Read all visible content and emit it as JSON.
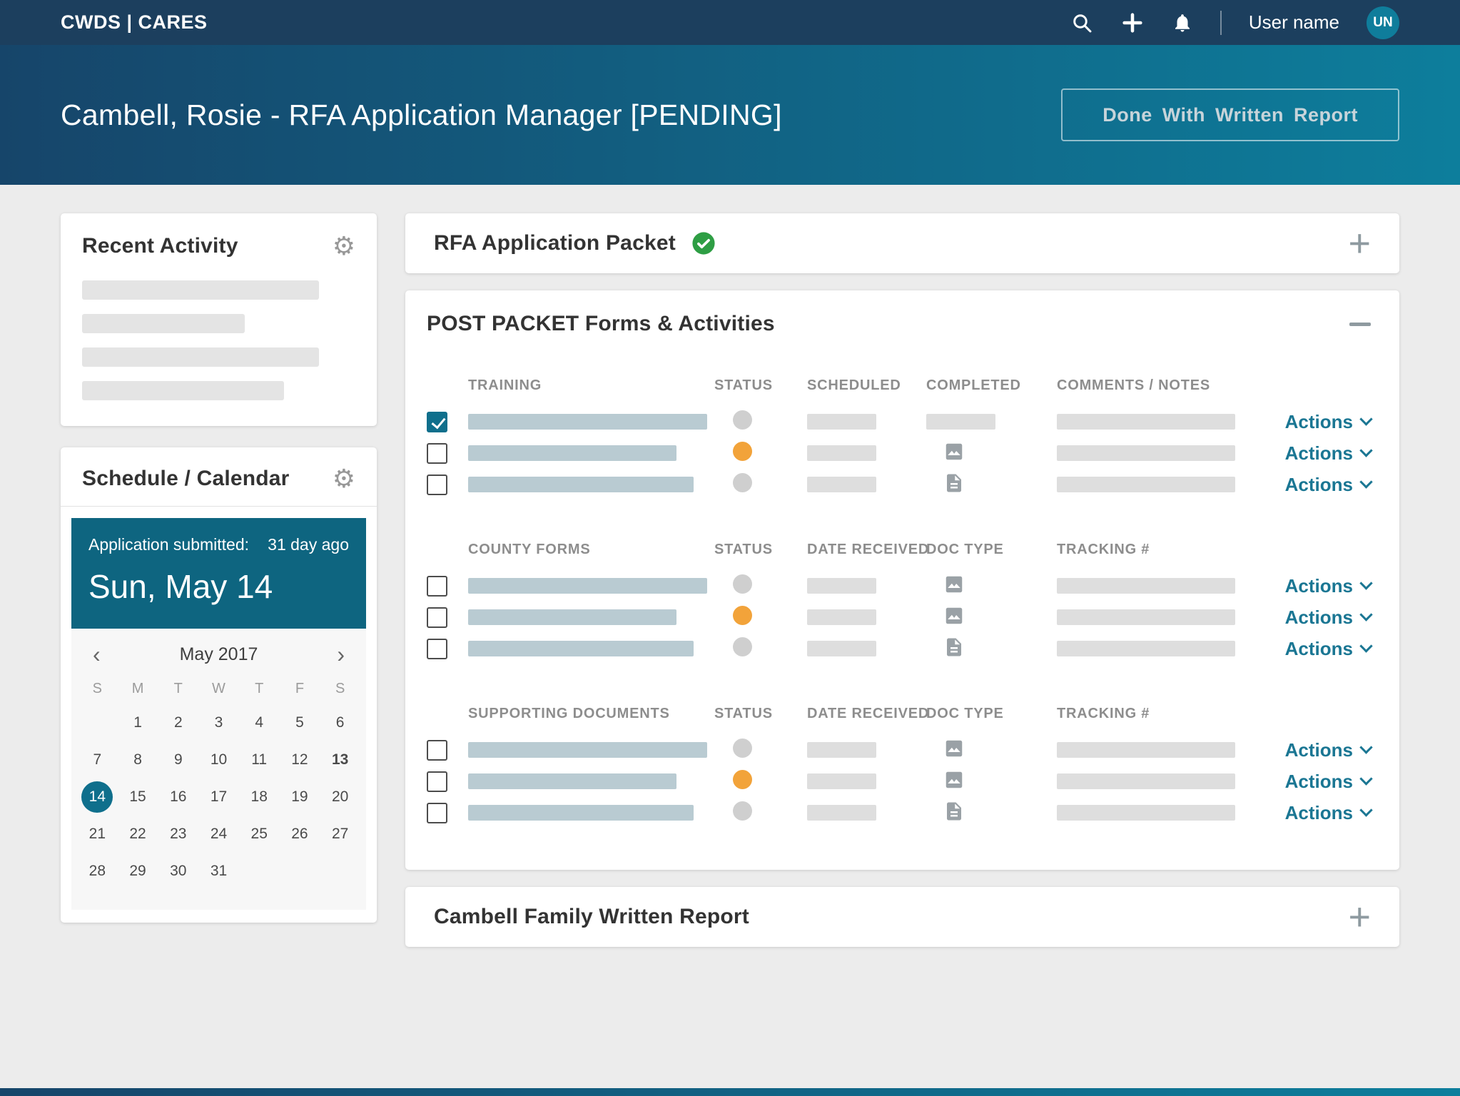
{
  "navbar": {
    "brand": "CWDS | CARES",
    "user_name": "User name",
    "avatar_initials": "UN"
  },
  "header": {
    "title": "Cambell, Rosie - RFA Application Manager [PENDING]",
    "button_label": "Done With Written Report"
  },
  "recent_activity": {
    "title": "Recent Activity"
  },
  "calendar_card": {
    "title": "Schedule / Calendar",
    "submitted_label": "Application submitted:",
    "submitted_ago": "31 day ago",
    "selected_date": "Sun, May 14",
    "month": "May 2017",
    "weekdays": [
      "S",
      "M",
      "T",
      "W",
      "T",
      "F",
      "S"
    ],
    "weeks": [
      [
        "",
        "1",
        "2",
        "3",
        "4",
        "5",
        "6"
      ],
      [
        "7",
        "8",
        "9",
        "10",
        "11",
        "12",
        "13"
      ],
      [
        "14",
        "15",
        "16",
        "17",
        "18",
        "19",
        "20"
      ],
      [
        "21",
        "22",
        "23",
        "24",
        "25",
        "26",
        "27"
      ],
      [
        "28",
        "29",
        "30",
        "31",
        "",
        "",
        ""
      ]
    ],
    "teal_days": [
      "7",
      "19",
      "25"
    ],
    "bold_days": [
      "13"
    ],
    "selected_day": "14"
  },
  "packet_card": {
    "title": "RFA Application Packet"
  },
  "post_packet": {
    "title": "POST PACKET Forms & Activities",
    "actions_label": "Actions",
    "sections": [
      {
        "headers": [
          "TRAINING",
          "STATUS",
          "SCHEDULED",
          "COMPLETED",
          "COMMENTS / NOTES"
        ],
        "rows": [
          {
            "checked": true,
            "status": "gray",
            "doc": "bar"
          },
          {
            "checked": false,
            "status": "orange",
            "doc": "image"
          },
          {
            "checked": false,
            "status": "gray",
            "doc": "doc"
          }
        ]
      },
      {
        "headers": [
          "COUNTY FORMS",
          "STATUS",
          "DATE RECEIVED",
          "DOC TYPE",
          "TRACKING #"
        ],
        "rows": [
          {
            "checked": false,
            "status": "gray",
            "doc": "image"
          },
          {
            "checked": false,
            "status": "orange",
            "doc": "image"
          },
          {
            "checked": false,
            "status": "gray",
            "doc": "doc"
          }
        ]
      },
      {
        "headers": [
          "SUPPORTING DOCUMENTS",
          "STATUS",
          "DATE RECEIVED",
          "DOC TYPE",
          "TRACKING #"
        ],
        "rows": [
          {
            "checked": false,
            "status": "gray",
            "doc": "image"
          },
          {
            "checked": false,
            "status": "orange",
            "doc": "image"
          },
          {
            "checked": false,
            "status": "gray",
            "doc": "doc"
          }
        ]
      }
    ]
  },
  "written_report": {
    "title": "Cambell Family Written Report"
  },
  "colors": {
    "accent_teal": "#0f6f8c",
    "status_orange": "#f2a33a",
    "status_gray": "#cfcfcf",
    "success_green": "#2e9e44",
    "navbar_blue": "#1c3f5e"
  }
}
